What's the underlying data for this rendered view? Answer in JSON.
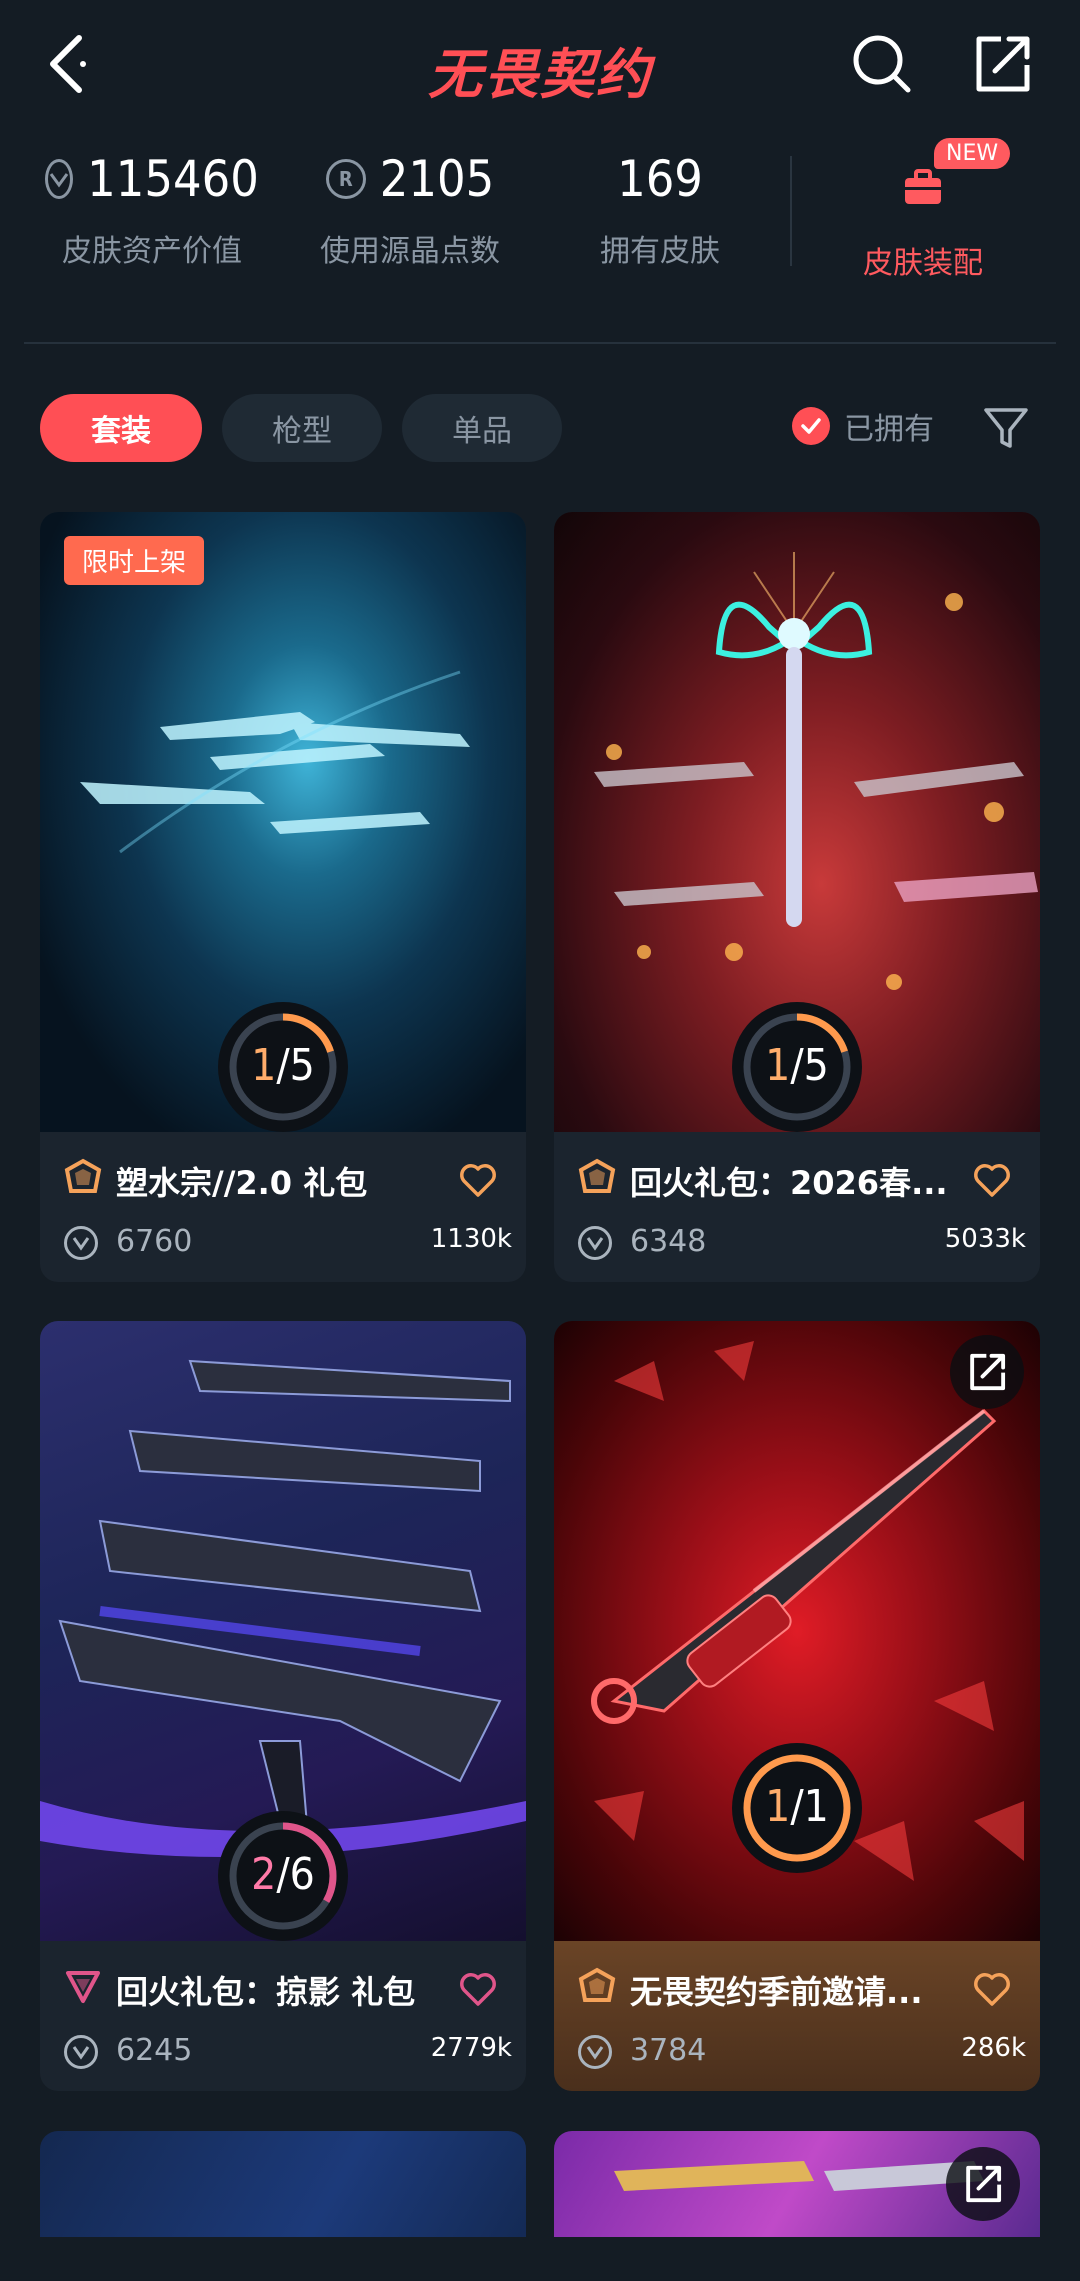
{
  "header": {
    "title": "无畏契约",
    "back_icon": "chevron-left-icon",
    "search_icon": "search-icon",
    "share_icon": "share-icon"
  },
  "stats": [
    {
      "value": "115460",
      "label": "皮肤资产价值",
      "icon": "vp-coin-icon"
    },
    {
      "value": "2105",
      "label": "使用源晶点数",
      "icon": "radianite-icon",
      "icon_text": "R"
    },
    {
      "value": "169",
      "label": "拥有皮肤"
    }
  ],
  "outfit": {
    "label": "皮肤装配",
    "badge": "NEW",
    "icon": "briefcase-icon"
  },
  "tabs": [
    {
      "label": "套装",
      "active": true
    },
    {
      "label": "枪型",
      "active": false
    },
    {
      "label": "单品",
      "active": false
    }
  ],
  "filter": {
    "owned_label": "已拥有",
    "owned_checked": true,
    "filter_icon": "funnel-icon"
  },
  "cards": [
    {
      "name": "塑水宗//2.0 礼包",
      "price": "6760",
      "likes": "1130k",
      "owned": "1",
      "total": "5",
      "tag": "限时上架",
      "tier": "gold",
      "theme": "blue"
    },
    {
      "name": "回火礼包：2026春...",
      "price": "6348",
      "likes": "5033k",
      "owned": "1",
      "total": "5",
      "tier": "gold",
      "theme": "red"
    },
    {
      "name": "回火礼包：掠影 礼包",
      "price": "6245",
      "likes": "2779k",
      "owned": "2",
      "total": "6",
      "tier": "pink",
      "theme": "purple"
    },
    {
      "name": "无畏契约季前邀请...",
      "price": "3784",
      "likes": "286k",
      "owned": "1",
      "total": "1",
      "tier": "gold",
      "theme": "crimson",
      "highlight": true
    }
  ],
  "colors": {
    "accent": "#ff4f55",
    "bg": "#141c24",
    "card": "#1b242e",
    "ring_progress": "#ff9a4d",
    "ring_pink": "#e0558a"
  }
}
